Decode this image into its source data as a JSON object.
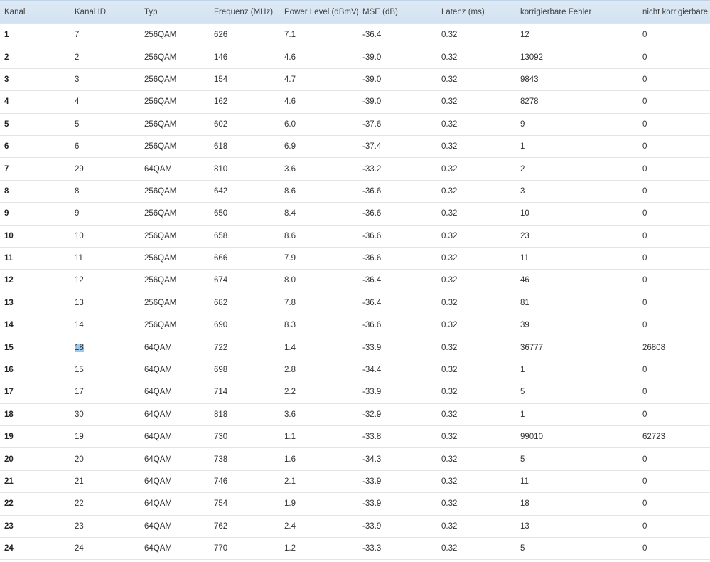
{
  "colors": {
    "header_bg": "#d6e5f3",
    "row_border": "#e4e4e4",
    "selection": "#99c9ef"
  },
  "table": {
    "headers": [
      "Kanal",
      "Kanal ID",
      "Typ",
      "Frequenz (MHz)",
      "Power Level (dBmV)",
      "MSE (dB)",
      "Latenz (ms)",
      "korrigierbare Fehler",
      "nicht korrigierbare F"
    ],
    "rows": [
      [
        "1",
        "7",
        "256QAM",
        "626",
        "7.1",
        "-36.4",
        "0.32",
        "12",
        "0"
      ],
      [
        "2",
        "2",
        "256QAM",
        "146",
        "4.6",
        "-39.0",
        "0.32",
        "13092",
        "0"
      ],
      [
        "3",
        "3",
        "256QAM",
        "154",
        "4.7",
        "-39.0",
        "0.32",
        "9843",
        "0"
      ],
      [
        "4",
        "4",
        "256QAM",
        "162",
        "4.6",
        "-39.0",
        "0.32",
        "8278",
        "0"
      ],
      [
        "5",
        "5",
        "256QAM",
        "602",
        "6.0",
        "-37.6",
        "0.32",
        "9",
        "0"
      ],
      [
        "6",
        "6",
        "256QAM",
        "618",
        "6.9",
        "-37.4",
        "0.32",
        "1",
        "0"
      ],
      [
        "7",
        "29",
        "64QAM",
        "810",
        "3.6",
        "-33.2",
        "0.32",
        "2",
        "0"
      ],
      [
        "8",
        "8",
        "256QAM",
        "642",
        "8.6",
        "-36.6",
        "0.32",
        "3",
        "0"
      ],
      [
        "9",
        "9",
        "256QAM",
        "650",
        "8.4",
        "-36.6",
        "0.32",
        "10",
        "0"
      ],
      [
        "10",
        "10",
        "256QAM",
        "658",
        "8.6",
        "-36.6",
        "0.32",
        "23",
        "0"
      ],
      [
        "11",
        "11",
        "256QAM",
        "666",
        "7.9",
        "-36.6",
        "0.32",
        "11",
        "0"
      ],
      [
        "12",
        "12",
        "256QAM",
        "674",
        "8.0",
        "-36.4",
        "0.32",
        "46",
        "0"
      ],
      [
        "13",
        "13",
        "256QAM",
        "682",
        "7.8",
        "-36.4",
        "0.32",
        "81",
        "0"
      ],
      [
        "14",
        "14",
        "256QAM",
        "690",
        "8.3",
        "-36.6",
        "0.32",
        "39",
        "0"
      ],
      [
        "15",
        "18",
        "64QAM",
        "722",
        "1.4",
        "-33.9",
        "0.32",
        "36777",
        "26808"
      ],
      [
        "16",
        "15",
        "64QAM",
        "698",
        "2.8",
        "-34.4",
        "0.32",
        "1",
        "0"
      ],
      [
        "17",
        "17",
        "64QAM",
        "714",
        "2.2",
        "-33.9",
        "0.32",
        "5",
        "0"
      ],
      [
        "18",
        "30",
        "64QAM",
        "818",
        "3.6",
        "-32.9",
        "0.32",
        "1",
        "0"
      ],
      [
        "19",
        "19",
        "64QAM",
        "730",
        "1.1",
        "-33.8",
        "0.32",
        "99010",
        "62723"
      ],
      [
        "20",
        "20",
        "64QAM",
        "738",
        "1.6",
        "-34.3",
        "0.32",
        "5",
        "0"
      ],
      [
        "21",
        "21",
        "64QAM",
        "746",
        "2.1",
        "-33.9",
        "0.32",
        "11",
        "0"
      ],
      [
        "22",
        "22",
        "64QAM",
        "754",
        "1.9",
        "-33.9",
        "0.32",
        "18",
        "0"
      ],
      [
        "23",
        "23",
        "64QAM",
        "762",
        "2.4",
        "-33.9",
        "0.32",
        "13",
        "0"
      ],
      [
        "24",
        "24",
        "64QAM",
        "770",
        "1.2",
        "-33.3",
        "0.32",
        "5",
        "0"
      ]
    ],
    "selected_cell": {
      "row": 14,
      "col": 1
    }
  }
}
